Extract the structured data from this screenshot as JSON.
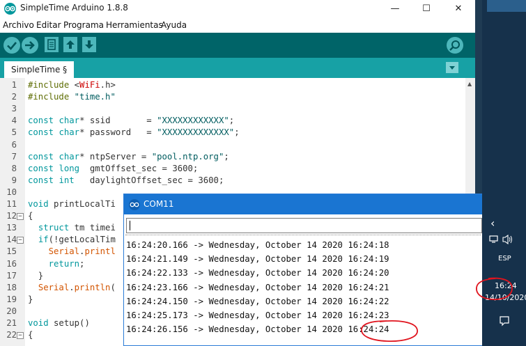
{
  "ide": {
    "window_title": "SimpleTime Arduino 1.8.8",
    "menu": [
      "Archivo",
      "Editar",
      "Programa",
      "Herramientas",
      "Ayuda"
    ],
    "tab_label": "SimpleTime §",
    "code_lines": [
      {
        "n": "1",
        "fold": "",
        "html": "<span class=\"pp\">#include</span> &lt;<span class=\"red\">WiFi</span>.h&gt;"
      },
      {
        "n": "2",
        "fold": "",
        "html": "<span class=\"pp\">#include</span> <span class=\"str\">\"time.h\"</span>"
      },
      {
        "n": "3",
        "fold": "",
        "html": ""
      },
      {
        "n": "4",
        "fold": "",
        "html": "<span class=\"kw\">const</span> <span class=\"ty\">char</span>* ssid       = <span class=\"str\">\"XXXXXXXXXXXX\"</span>;"
      },
      {
        "n": "5",
        "fold": "",
        "html": "<span class=\"kw\">const</span> <span class=\"ty\">char</span>* password   = <span class=\"str\">\"XXXXXXXXXXXXX\"</span>;"
      },
      {
        "n": "6",
        "fold": "",
        "html": ""
      },
      {
        "n": "7",
        "fold": "",
        "html": "<span class=\"kw\">const</span> <span class=\"ty\">char</span>* ntpServer = <span class=\"str\">\"pool.ntp.org\"</span>;"
      },
      {
        "n": "8",
        "fold": "",
        "html": "<span class=\"kw\">const</span> <span class=\"ty\">long</span>  gmtOffset_sec = 3600;"
      },
      {
        "n": "9",
        "fold": "",
        "html": "<span class=\"kw\">const</span> <span class=\"ty\">int</span>   daylightOffset_sec = 3600;"
      },
      {
        "n": "10",
        "fold": "",
        "html": ""
      },
      {
        "n": "11",
        "fold": "",
        "html": "<span class=\"ty\">void</span> printLocalTi"
      },
      {
        "n": "12",
        "fold": "-",
        "html": "{"
      },
      {
        "n": "13",
        "fold": "",
        "html": "  <span class=\"kw\">struct</span> tm timei"
      },
      {
        "n": "14",
        "fold": "-",
        "html": "  <span class=\"kw\">if</span>(!getLocalTim"
      },
      {
        "n": "15",
        "fold": "",
        "html": "    <span class=\"fn\">Serial</span>.<span class=\"fn\">printl</span>"
      },
      {
        "n": "16",
        "fold": "",
        "html": "    <span class=\"kw\">return</span>;"
      },
      {
        "n": "17",
        "fold": "",
        "html": "  }"
      },
      {
        "n": "18",
        "fold": "",
        "html": "  <span class=\"fn\">Serial</span>.<span class=\"fn\">println</span>("
      },
      {
        "n": "19",
        "fold": "",
        "html": "}"
      },
      {
        "n": "20",
        "fold": "",
        "html": ""
      },
      {
        "n": "21",
        "fold": "",
        "html": "<span class=\"ty\">void</span> setup()"
      },
      {
        "n": "22",
        "fold": "-",
        "html": "{"
      }
    ]
  },
  "serial": {
    "window_title": "COM11",
    "input_value": "",
    "lines": [
      "16:24:20.166 -> Wednesday, October 14 2020 16:24:18",
      "16:24:21.149 -> Wednesday, October 14 2020 16:24:19",
      "16:24:22.133 -> Wednesday, October 14 2020 16:24:20",
      "16:24:23.166 -> Wednesday, October 14 2020 16:24:21",
      "16:24:24.150 -> Wednesday, October 14 2020 16:24:22",
      "16:24:25.173 -> Wednesday, October 14 2020 16:24:23",
      "16:24:26.156 -> Wednesday, October 14 2020 16:24:24"
    ]
  },
  "taskbar": {
    "language": "ESP",
    "clock_time": "16:24",
    "clock_date": "14/10/2020"
  },
  "colors": {
    "toolbar": "#006468",
    "tabs": "#17a1a5",
    "annotation": "#e0141e",
    "taskbar": "#16314b"
  }
}
